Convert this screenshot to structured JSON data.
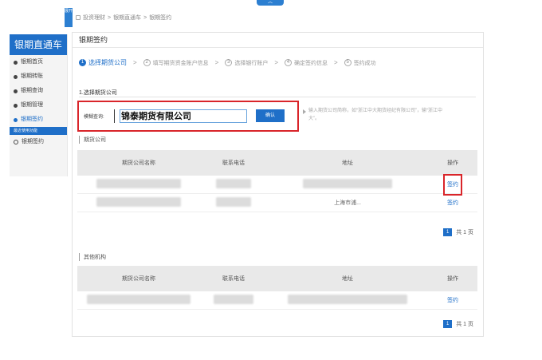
{
  "top_handle": {
    "label": "︿"
  },
  "sidebar_toggle": {
    "label": "展开"
  },
  "breadcrumb": [
    "投资理财",
    "银期直通车",
    "银期签约"
  ],
  "breadcrumb_sep": ">",
  "sidebar": {
    "title": "银期直通车",
    "items": [
      {
        "label": "银期首页"
      },
      {
        "label": "银期转账"
      },
      {
        "label": "银期查询"
      },
      {
        "label": "银期管理"
      },
      {
        "label": "银期签约"
      }
    ],
    "recent_label": "最近使用功能",
    "recent_items": [
      {
        "label": "银期签约"
      }
    ]
  },
  "page": {
    "title": "银期签约"
  },
  "steps": [
    {
      "num": "1",
      "label": "选择期货公司"
    },
    {
      "num": "2",
      "label": "填写期货资金账户信息"
    },
    {
      "num": "3",
      "label": "选择银行账户"
    },
    {
      "num": "4",
      "label": "确定签约信息"
    },
    {
      "num": "5",
      "label": "签约成功"
    }
  ],
  "step_arrow": ">",
  "section": {
    "title": "1.选择期货公司"
  },
  "query": {
    "label": "模糊查询:",
    "value": "锦泰期货有限公司",
    "confirm": "确认",
    "hint": "输入期货公司简称，如“浙江中大期货经纪有限公司”，输“浙江中大”。"
  },
  "futures_table": {
    "group_label": "期货公司",
    "columns": [
      "期货公司名称",
      "联系电话",
      "地址",
      "操作"
    ],
    "rows": [
      {
        "address_partial": "",
        "action": "签约"
      },
      {
        "address_partial": "上海市浦...",
        "action": "签约"
      }
    ],
    "pager": {
      "page": "1",
      "total": "共 1 页"
    }
  },
  "other_table": {
    "group_label": "其他机构",
    "columns": [
      "期货公司名称",
      "联系电话",
      "地址",
      "操作"
    ],
    "rows": [
      {
        "action": "签约"
      }
    ],
    "pager": {
      "page": "1",
      "total": "共 1 页"
    }
  },
  "colors": {
    "primary": "#1f6fc8",
    "highlight": "#d9252a"
  }
}
